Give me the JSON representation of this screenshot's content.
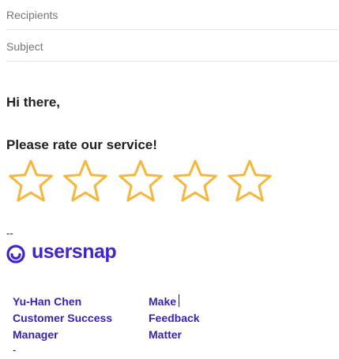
{
  "compose": {
    "recipients_placeholder": "Recipients",
    "subject_placeholder": "Subject"
  },
  "body": {
    "greeting": "Hi there,",
    "rating_prompt": "Please rate our service!",
    "rating": {
      "max": 5,
      "star_icon": "star-outline-icon",
      "star_color": "#f5b63a"
    }
  },
  "signature": {
    "separator": "--",
    "brand": {
      "name": "usersnap",
      "color": "#4326c8",
      "icon": "usersnap-logo-icon"
    },
    "name_lines": [
      "Yu-Han Chen",
      "Customer Success",
      "Manager"
    ],
    "tagline_lines": [
      "Make",
      "Feedback",
      "Matter"
    ],
    "link_color": "#3a1fb5",
    "trailing": "-"
  }
}
